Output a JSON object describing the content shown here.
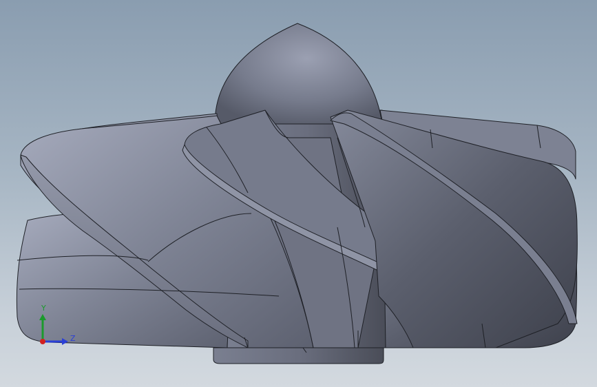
{
  "viewport": {
    "background_top": "#8a9db0",
    "background_bottom": "#d3d9df",
    "model_color": "#6e7282",
    "edge_color": "#1e2026"
  },
  "model": {
    "name": "impeller",
    "parts": [
      "nose-cone",
      "hub",
      "blade",
      "blade",
      "blade",
      "blade",
      "blade"
    ]
  },
  "triad": {
    "y_label": "Y",
    "z_label": "Z",
    "y_color": "#1b9a2c",
    "z_color": "#2a3fd6",
    "x_color": "#d12020"
  }
}
